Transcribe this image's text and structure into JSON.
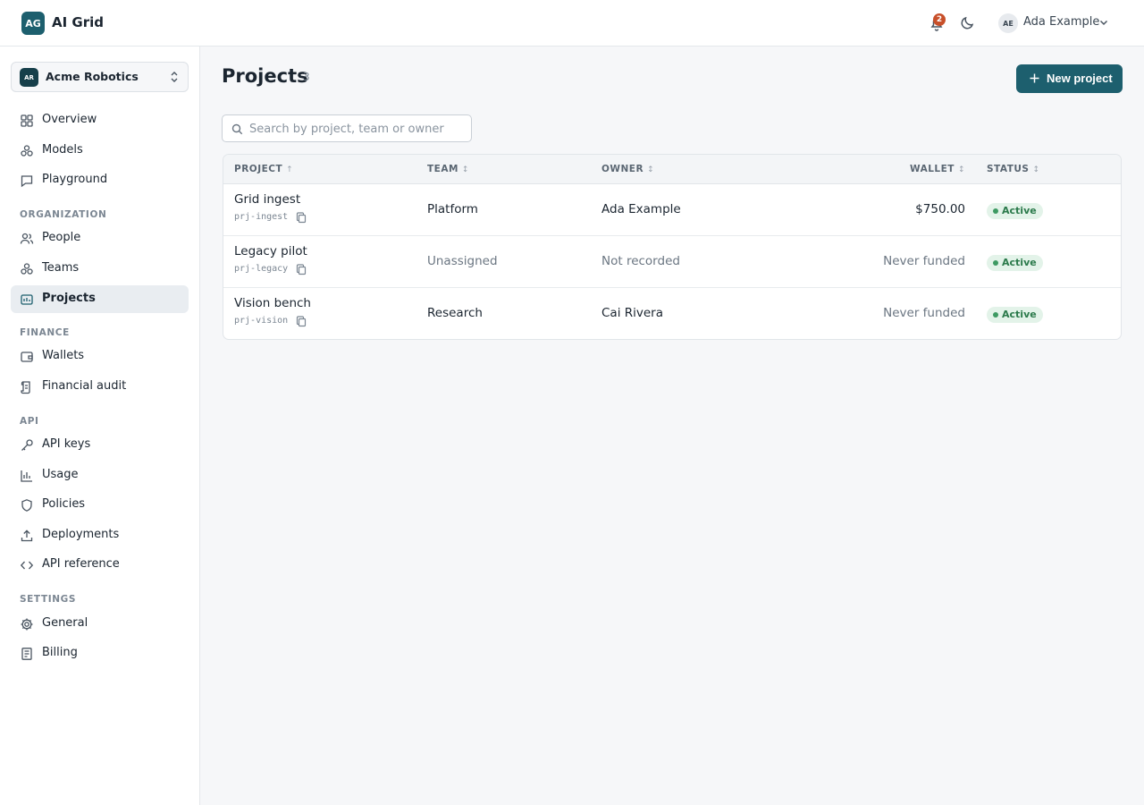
{
  "app": {
    "badge": "AG",
    "name": "AI Grid"
  },
  "topbar": {
    "notifications_count": "2",
    "user": {
      "initials": "AE",
      "name": "Ada Example"
    }
  },
  "sidebar": {
    "org": {
      "initials": "AR",
      "name": "Acme Robotics"
    },
    "items_top": [
      {
        "label": "Overview",
        "icon": "grid-icon"
      },
      {
        "label": "Models",
        "icon": "models-icon"
      },
      {
        "label": "Playground",
        "icon": "chat-icon"
      }
    ],
    "sections": [
      {
        "title": "ORGANIZATION",
        "items": [
          {
            "label": "People",
            "icon": "people-icon"
          },
          {
            "label": "Teams",
            "icon": "teams-icon"
          },
          {
            "label": "Projects",
            "icon": "projects-icon",
            "active": true
          }
        ]
      },
      {
        "title": "FINANCE",
        "items": [
          {
            "label": "Wallets",
            "icon": "wallet-icon"
          },
          {
            "label": "Financial audit",
            "icon": "audit-icon"
          }
        ]
      },
      {
        "title": "API",
        "items": [
          {
            "label": "API keys",
            "icon": "key-icon"
          },
          {
            "label": "Usage",
            "icon": "bar-chart-icon"
          },
          {
            "label": "Policies",
            "icon": "shield-icon"
          },
          {
            "label": "Deployments",
            "icon": "upload-icon"
          },
          {
            "label": "API reference",
            "icon": "code-icon"
          }
        ]
      },
      {
        "title": "SETTINGS",
        "items": [
          {
            "label": "General",
            "icon": "gear-icon"
          },
          {
            "label": "Billing",
            "icon": "receipt-icon"
          }
        ]
      }
    ]
  },
  "main": {
    "title": "Projects",
    "count": "3",
    "new_button": "New project",
    "search_placeholder": "Search by project, team or owner",
    "columns": [
      "PROJECT",
      "TEAM",
      "OWNER",
      "WALLET",
      "STATUS"
    ],
    "sort_marks": [
      "↑",
      "↕",
      "↕",
      "↕",
      "↕"
    ],
    "rows": [
      {
        "name": "Grid ingest",
        "id": "prj-ingest",
        "team": "Platform",
        "team_muted": false,
        "owner": "Ada Example",
        "owner_muted": false,
        "wallet": "$750.00",
        "wallet_muted": false,
        "status": "Active"
      },
      {
        "name": "Legacy pilot",
        "id": "prj-legacy",
        "team": "Unassigned",
        "team_muted": true,
        "owner": "Not recorded",
        "owner_muted": true,
        "wallet": "Never funded",
        "wallet_muted": true,
        "status": "Active"
      },
      {
        "name": "Vision bench",
        "id": "prj-vision",
        "team": "Research",
        "team_muted": false,
        "owner": "Cai Rivera",
        "owner_muted": false,
        "wallet": "Never funded",
        "wallet_muted": true,
        "status": "Active"
      }
    ]
  },
  "colors": {
    "accent": "#1d5f6e",
    "status_active": "#2b7a4b",
    "notification": "#c8502a"
  }
}
